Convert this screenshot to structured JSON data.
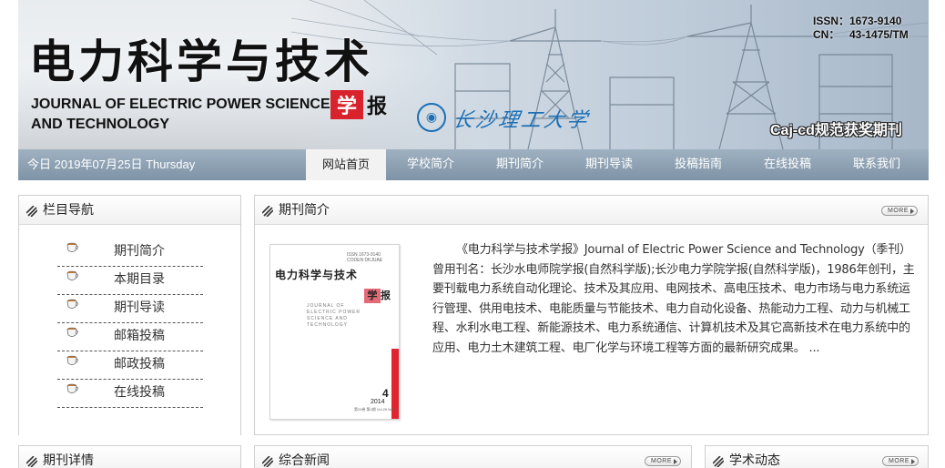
{
  "header": {
    "title_cn": "电力科学与技术",
    "xue": "学",
    "bao": "报",
    "title_en_line1": "JOURNAL OF ELECTRIC POWER SCIENCE",
    "title_en_line2": "AND TECHNOLOGY",
    "university_name": "长沙理工大学",
    "issn_label": "ISSN：",
    "issn_value": "1673-9140",
    "cn_label": "CN：",
    "cn_value": "43-1475/TM",
    "award": "Caj-cd规范获奖期刊"
  },
  "nav": {
    "date": "今日 2019年07月25日 Thursday",
    "items": [
      {
        "label": "网站首页",
        "active": true
      },
      {
        "label": "学校简介"
      },
      {
        "label": "期刊简介"
      },
      {
        "label": "期刊导读"
      },
      {
        "label": "投稿指南"
      },
      {
        "label": "在线投稿"
      },
      {
        "label": "联系我们"
      }
    ]
  },
  "sidebar": {
    "title": "栏目导航",
    "items": [
      {
        "label": "期刊简介"
      },
      {
        "label": "本期目录"
      },
      {
        "label": "期刊导读"
      },
      {
        "label": "邮箱投稿"
      },
      {
        "label": "邮政投稿"
      },
      {
        "label": "在线投稿"
      }
    ]
  },
  "intro": {
    "title": "期刊简介",
    "more": "MORE",
    "text": "《电力科学与技术学报》Journal of Electric Power Science and Technology（季刊）曾用刊名：长沙水电师院学报(自然科学版);长沙电力学院学报(自然科学版)，1986年创刊，主要刊载电力系统自动化理论、技术及其应用、电网技术、高电压技术、电力市场与电力系统运行管理、供用电技术、电能质量与节能技术、电力自动化设备、热能动力工程、动力与机械工程、水利水电工程、新能源技术、电力系统通信、计算机技术及其它高新技术在电力系统中的应用、电力土木建筑工程、电厂化学与环境工程等方面的最新研究成果。 ...",
    "cover": {
      "issn": "ISSN 1673-9140",
      "coden": "CODEN DKJUAE",
      "title": "电力科学与技术",
      "xue": "学",
      "bao": "报",
      "en": "JOURNAL OF ELECTRIC POWER SCIENCE AND TECHNOLOGY",
      "issue": "4",
      "year": "2014",
      "vol": "第29卷 第4期 Vol.29 No.4"
    }
  },
  "bottom": {
    "detail_title": "期刊详情",
    "news_title": "综合新闻",
    "academic_title": "学术动态",
    "more": "MORE"
  }
}
